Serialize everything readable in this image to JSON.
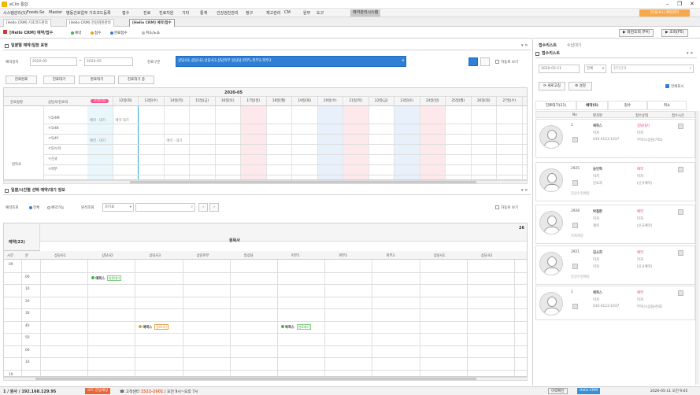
{
  "window": {
    "title": "eClin 통합"
  },
  "menu": {
    "items": [
      "시스템관리(S)",
      "Foods·Se",
      "Master",
      "병동간호업무",
      "기초코드등록",
      "접수",
      "진료",
      "진료지원",
      "기타",
      "통계",
      "건강검진관리",
      "청구",
      "재고관리",
      "CM",
      "원무",
      "도구",
      "예약관리시스템"
    ],
    "badge": "안내(#1) 예약관리"
  },
  "tabs": [
    "[Hello CRM] 기초코드관리",
    "[Hello CRM] 건강검진관리",
    "[Hello CRM] 예약/접수"
  ],
  "toolbar": {
    "module": "[Hello CRM] 예약/접수",
    "legend": [
      {
        "label": "예약",
        "color": "#3fb64a"
      },
      {
        "label": "접수",
        "color": "#f29b21"
      },
      {
        "label": "완료접수",
        "color": "#3a7bd5"
      },
      {
        "label": "취소/노쇼",
        "color": "#bbbbbb"
      }
    ],
    "btn_view": "▶ 화면조회 (F4)",
    "btn_search": "▶ 조회(F5)"
  },
  "schedule": {
    "panel_title": "일괄별 예약/일정 표현",
    "date_label": "예약일자",
    "date_from": "2020-05",
    "date_to": "2020-05",
    "dept_label": "진료구분",
    "dept_value": "상담사1,상담사2,상담사3,상담피부,일상담,피부1,피부2,피부3",
    "auto_label": "자동로 보기",
    "filters": [
      "진료완료",
      "진료대기",
      "완료대기",
      "진료대기 중"
    ],
    "month": "2020-05",
    "row_headers": [
      "진료실명",
      "상담사/진료의"
    ],
    "days": [
      "10일(일)",
      "12일(화)",
      "13일(수)",
      "14일(목)",
      "15일(금)",
      "16일(토)",
      "17일(일)",
      "18일(월)",
      "19일(화)",
      "20일(수)",
      "21일(목)",
      "22일(금)",
      "23일(토)",
      "24일(일)",
      "25일(월)",
      "26일(화)",
      "27일(수)"
    ],
    "group": "원목사",
    "rows": [
      "ㅇ5/4M",
      "ㅇ5/4K",
      "ㅇ5/4Y",
      "ㅇ5/누락",
      "ㅇ신규",
      "ㅇ피부"
    ],
    "cells": [
      {
        "day": 0,
        "row": 0,
        "text": "예약 · 대기"
      },
      {
        "day": 1,
        "row": 0,
        "text": "예약 대기"
      },
      {
        "day": 0,
        "row": 2,
        "text": "예약 · 대기"
      },
      {
        "day": 3,
        "row": 2,
        "text": "예약 · 대기"
      }
    ]
  },
  "detail": {
    "panel_title": "일괄/시간별 선택 예약/대기 정보",
    "type_label": "예약조회",
    "radio_all": "전체",
    "radio_avail": "예약가능",
    "doctor_label": "원석조회",
    "doctor_value": "조이표",
    "auto_label": "자동로 보기",
    "side_title": "예약(22)",
    "group": "원목사",
    "columns": [
      "상담사1",
      "상담사2",
      "상담사3",
      "상담피부",
      "일상담",
      "피부1",
      "피부2",
      "피부3",
      "상담사1",
      "상담사2"
    ],
    "time_heads": [
      "시간",
      "분"
    ],
    "times": [
      "09",
      "",
      "",
      "",
      "",
      "",
      "",
      "",
      "",
      "10"
    ],
    "mins": [
      "",
      "00",
      "10",
      "20",
      "30",
      "40",
      "50",
      "00",
      "10"
    ],
    "appointments": [
      {
        "col": 1,
        "row": 1,
        "name": "예목스",
        "status": "완료대기",
        "kind": "green"
      },
      {
        "col": 2,
        "row": 5,
        "name": "예목스",
        "status": "완료대기",
        "kind": "orange"
      },
      {
        "col": 5,
        "row": 5,
        "name": "복목스",
        "status": "완료대기",
        "kind": "green"
      }
    ]
  },
  "right": {
    "panel_title": "접수리스트",
    "sub_title": "수납대기",
    "list_title": "접수리스트",
    "date": "2020-05-11",
    "filter": "전체",
    "search_placeholder": "환자검색",
    "btn_refresh": "새로고침",
    "btn_setting": "설정",
    "checkbox_label": "전체표시",
    "tabs": [
      "진료대기(21)",
      "예약(5)",
      "접수",
      "취소"
    ],
    "cols": [
      "No",
      "환자명",
      "접수상태",
      "접수시간"
    ],
    "cards": [
      {
        "no": "1",
        "name": "예목스",
        "status": "상담대기",
        "sub": "미처",
        "phone": "010-4123-1037",
        "note": "부목스(상담/기타)",
        "extra": ""
      },
      {
        "no": "2925",
        "name": "송민혁",
        "status": "예약",
        "sub": "미처",
        "phone": "진료과",
        "note": "(신규예약)",
        "extra": "감상수정예정"
      },
      {
        "no": "2928",
        "name": "박철환",
        "status": "예약",
        "sub": "미처",
        "phone": "제목",
        "note": "(신규예약)",
        "extra": "목록예정"
      },
      {
        "no": "2921",
        "name": "김소희",
        "status": "예약",
        "sub": "미처",
        "phone": "미처",
        "note": "(신규예약)",
        "extra": "감상수정예정"
      },
      {
        "no": "1",
        "name": "예목스",
        "status": "예약",
        "sub": "미처",
        "phone": "010-4123-1037",
        "note": "부목스(상담/진료)",
        "extra": ""
      }
    ]
  },
  "status": {
    "user": "1 / 원사",
    "ip": "192.168.129.95",
    "mode": "모드 안녕세상",
    "call_label": "고객센터",
    "call_number": "1522-2601",
    "hours": "오전 9시~오후 7시",
    "update": "이력확인",
    "ver": "Hello CRM",
    "datetime": "2020-05-11 오전 9:05"
  }
}
